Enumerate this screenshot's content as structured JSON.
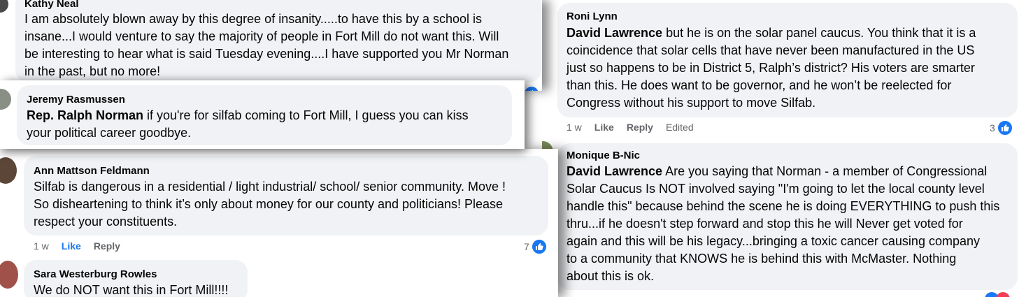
{
  "right_panel": {
    "comment_roni": {
      "author": "Roni Lynn",
      "mention": "David Lawrence",
      "lines": [
        " but he is on the solar panel caucus. You think that it is a",
        "coincidence that solar cells that have never been manufactured in the US",
        "just so happens to be in District 5, Ralph’s district? His voters are smarter",
        "than this. He does want to be governor, and he won’t be reelected for",
        "Congress without his support to move Silfab."
      ],
      "time": "1 w",
      "like": "Like",
      "reply": "Reply",
      "edited": "Edited",
      "reaction_count": "3"
    },
    "comment_monique": {
      "author": "Monique B-Nic",
      "mention": "David Lawrence",
      "lines": [
        " Are you saying that Norman - a member of Congressional",
        "Solar Caucus Is NOT involved saying \"I'm going to let the local county level",
        "handle this\" because behind the scene he is doing EVERYTHING to push this",
        "thru...if he doesn't step forward and stop this he will Never get voted for",
        "again and this will be his legacy...bringing a toxic cancer causing company",
        "to a community that KNOWS he is behind this with McMaster. Nothing",
        "about this is ok."
      ]
    }
  },
  "left_panel": {
    "comment_kathy": {
      "author": "Kathy Neal",
      "lines": [
        "I am absolutely blown away by this degree of insanity.....to have this by a school is",
        "insane...I would venture to say the majority of people in Fort Mill do not want this. Will",
        "be interesting to hear what is said Tuesday evening....I have supported you Mr Norman",
        "in the past, but no more!"
      ]
    },
    "comment_jeremy": {
      "author": "Jeremy Rasmussen",
      "mention": "Rep. Ralph Norman",
      "lines": [
        " if you're for silfab coming to Fort Mill, I guess you can kiss",
        "your political career goodbye."
      ]
    },
    "comment_ann": {
      "author": "Ann Mattson Feldmann",
      "lines": [
        "Silfab is dangerous in a residential / light industrial/ school/ senior community. Move !",
        "So disheartening to think it’s only about money for our county and politicians! Please",
        "respect your constituents."
      ],
      "time": "1 w",
      "like": "Like",
      "reply": "Reply",
      "reaction_count": "7"
    },
    "comment_sara": {
      "author": "Sara Westerburg Rowles",
      "lines": [
        "We do NOT want this in Fort Mill!!!!"
      ]
    }
  },
  "colors": {
    "bubble": "#f0f2f5",
    "like_blue": "#1877f2",
    "meta_gray": "#65676b",
    "love_red": "#f33e58"
  },
  "icons": [
    "like-reaction-icon",
    "love-reaction-icon",
    "avatar"
  ]
}
